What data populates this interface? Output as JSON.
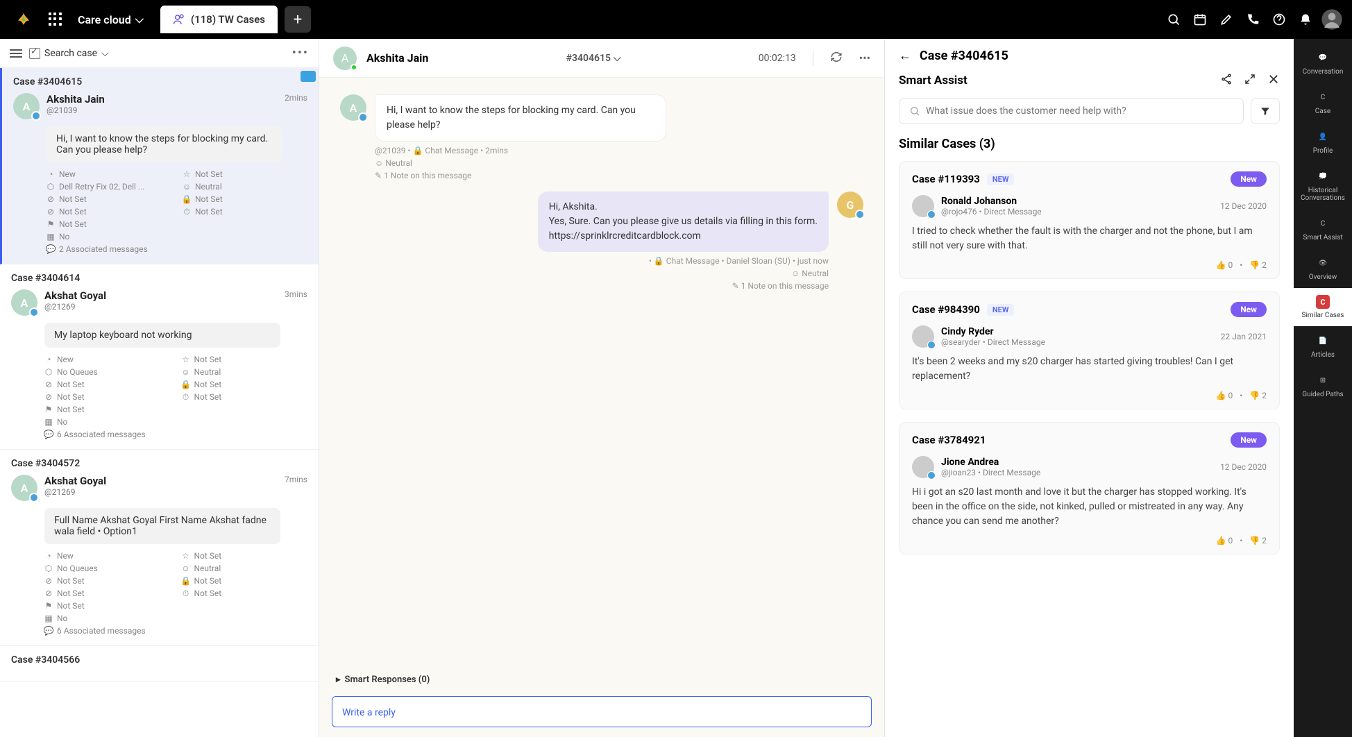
{
  "topbar": {
    "workspace": "Care cloud",
    "tab_label": "(118) TW Cases"
  },
  "left": {
    "search_label": "Search case",
    "cases": [
      {
        "id": "Case #3404615",
        "name": "Akshita Jain",
        "handle": "@21039",
        "time": "2mins",
        "preview": "Hi, I want to know the steps for blocking my card. Can you please help?",
        "meta_l": [
          "New",
          "Dell Retry Fix 02, Dell ...",
          "Not Set",
          "Not Set",
          "Not Set",
          "No"
        ],
        "meta_r": [
          "Not Set",
          "Neutral",
          "Not Set",
          "Not Set"
        ],
        "assoc": "2 Associated messages",
        "active": true,
        "flag": true
      },
      {
        "id": "Case #3404614",
        "name": "Akshat Goyal",
        "handle": "@21269",
        "time": "3mins",
        "preview": "My laptop keyboard not working",
        "meta_l": [
          "New",
          "No Queues",
          "Not Set",
          "Not Set",
          "Not Set",
          "No"
        ],
        "meta_r": [
          "Not Set",
          "Neutral",
          "Not Set",
          "Not Set"
        ],
        "assoc": "6 Associated messages"
      },
      {
        "id": "Case #3404572",
        "name": "Akshat Goyal",
        "handle": "@21269",
        "time": "7mins",
        "preview": "Full Name  Akshat Goyal First Name Akshat fadne wala field • Option1",
        "meta_l": [
          "New",
          "No Queues",
          "Not Set",
          "Not Set",
          "Not Set",
          "No"
        ],
        "meta_r": [
          "Not Set",
          "Neutral",
          "Not Set",
          "Not Set"
        ],
        "assoc": "6 Associated messages"
      },
      {
        "id": "Case #3404566"
      }
    ]
  },
  "center": {
    "name": "Akshita Jain",
    "case_id": "#3404615",
    "timer": "00:02:13",
    "messages": [
      {
        "side": "left",
        "text": "Hi, I want to know the steps for blocking my card. Can you please help?",
        "meta1": "@21039  •  🔒 Chat Message  •  2mins",
        "meta2": "Neutral",
        "meta3": "1 Note on this message"
      },
      {
        "side": "right",
        "text": "Hi, Akshita.\nYes, Sure. Can you please give us details via filling in this form.\nhttps://sprinklrcreditcardblock.com",
        "meta1": "🔒 Chat Message  •  Daniel Sloan (SU)  •  just now",
        "meta2": "Neutral",
        "meta3": "1 Note on this message"
      }
    ],
    "smart_responses": "Smart Responses (0)",
    "reply_placeholder": "Write a reply"
  },
  "right": {
    "case_header": "Case #3404615",
    "panel_title": "Smart Assist",
    "search_placeholder": "What issue does the customer need help with?",
    "section": "Similar Cases (3)",
    "cards": [
      {
        "case": "Case #119393",
        "badge": "NEW",
        "pill": "New",
        "user": "Ronald Johanson",
        "handle": "@rojo476 • Direct Message",
        "date": "12 Dec 2020",
        "body": "I tried to check whether the fault is with the charger and not the phone, but I am still not very sure with that.",
        "up": "0",
        "down": "2"
      },
      {
        "case": "Case #984390",
        "badge": "NEW",
        "pill": "New",
        "user": "Cindy Ryder",
        "handle": "@searyder • Direct Message",
        "date": "22 Jan 2021",
        "body": "It's been 2 weeks and my s20 charger has started giving troubles! Can I get replacement?",
        "up": "0",
        "down": "2"
      },
      {
        "case": "Case #3784921",
        "badge": "",
        "pill": "New",
        "user": "Jione Andrea",
        "handle": "@jioan23 • Direct Message",
        "date": "12 Dec 2020",
        "body": "Hi i got an s20 last month and love it but the charger has stopped working.  It's been in the office on the side, not kinked, pulled or mistreated in any way. Any chance you can send me another?",
        "up": "0",
        "down": "2"
      }
    ]
  },
  "rail": [
    {
      "label": "Conversation",
      "icon": "💬"
    },
    {
      "label": "Case",
      "icon": "C"
    },
    {
      "label": "Profile",
      "icon": "👤"
    },
    {
      "label": "Historical Conversations",
      "icon": "💭"
    },
    {
      "label": "Smart Assist",
      "icon": "C"
    },
    {
      "label": "Overview",
      "icon": "👁"
    },
    {
      "label": "Similar Cases",
      "icon": "C",
      "highlight": true
    },
    {
      "label": "Articles",
      "icon": "📄"
    },
    {
      "label": "Guided Paths",
      "icon": "⊞"
    }
  ]
}
